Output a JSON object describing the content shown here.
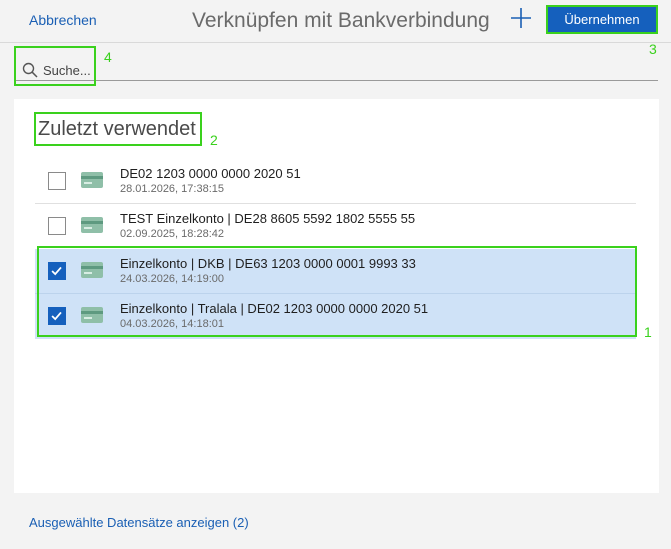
{
  "header": {
    "cancel_label": "Abbrechen",
    "title": "Verknüpfen mit Bankverbindung",
    "apply_label": "Übernehmen",
    "add_icon": "plus-icon"
  },
  "search": {
    "placeholder": "Suche...",
    "value": "",
    "icon": "search-icon"
  },
  "section": {
    "title": "Zuletzt verwendet"
  },
  "rows": [
    {
      "main": "DE02 1203 0000 0000 2020 51",
      "sub": "28.01.2026, 17:38:15",
      "checked": false
    },
    {
      "main": "TEST Einzelkonto | DE28 8605 5592 1802 5555 55",
      "sub": "02.09.2025, 18:28:42",
      "checked": false
    },
    {
      "main": "Einzelkonto | DKB | DE63 1203 0000 0001 9993 33",
      "sub": "24.03.2026, 14:19:00",
      "checked": true
    },
    {
      "main": "Einzelkonto | Tralala | DE02 1203 0000 0000 2020 51",
      "sub": "04.03.2026, 14:18:01",
      "checked": true
    }
  ],
  "footer": {
    "link_label": "Ausgewählte Datensätze anzeigen (2)"
  },
  "annotations": [
    "1",
    "2",
    "3",
    "4"
  ],
  "colors": {
    "accent": "#1560bd",
    "highlight_frame": "#3ad11d",
    "selected_row": "#cfe2f7"
  }
}
